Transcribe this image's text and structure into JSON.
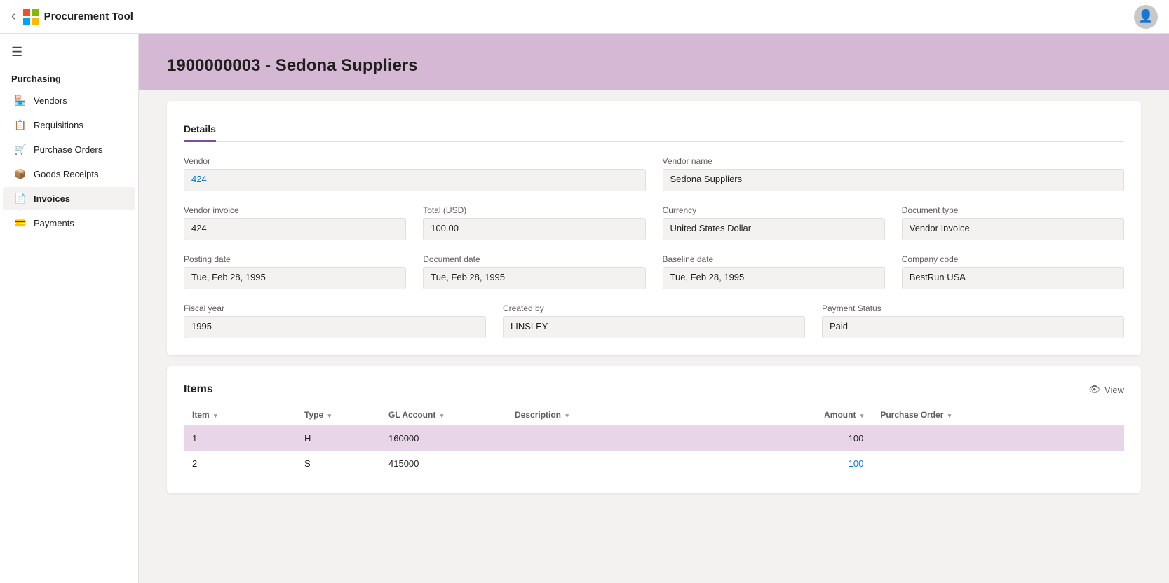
{
  "app": {
    "title": "Microsoft  Procurement Tool"
  },
  "topbar": {
    "back_label": "‹",
    "app_name": "Procurement Tool"
  },
  "sidebar": {
    "section_label": "Purchasing",
    "hamburger": "☰",
    "items": [
      {
        "id": "vendors",
        "label": "Vendors",
        "icon": "🏪",
        "active": false
      },
      {
        "id": "requisitions",
        "label": "Requisitions",
        "icon": "📋",
        "active": false
      },
      {
        "id": "purchase-orders",
        "label": "Purchase Orders",
        "icon": "🛒",
        "active": false
      },
      {
        "id": "goods-receipts",
        "label": "Goods Receipts",
        "icon": "📦",
        "active": false
      },
      {
        "id": "invoices",
        "label": "Invoices",
        "icon": "📄",
        "active": true
      },
      {
        "id": "payments",
        "label": "Payments",
        "icon": "💳",
        "active": false
      }
    ]
  },
  "page": {
    "title": "1900000003 - Sedona Suppliers",
    "tab_label": "Details"
  },
  "details": {
    "vendor_label": "Vendor",
    "vendor_value": "424",
    "vendor_name_label": "Vendor name",
    "vendor_name_value": "Sedona Suppliers",
    "vendor_invoice_label": "Vendor invoice",
    "vendor_invoice_value": "424",
    "total_label": "Total (USD)",
    "total_value": "100.00",
    "currency_label": "Currency",
    "currency_value": "United States Dollar",
    "document_type_label": "Document type",
    "document_type_value": "Vendor Invoice",
    "posting_date_label": "Posting date",
    "posting_date_value": "Tue, Feb 28, 1995",
    "document_date_label": "Document date",
    "document_date_value": "Tue, Feb 28, 1995",
    "baseline_date_label": "Baseline date",
    "baseline_date_value": "Tue, Feb 28, 1995",
    "company_code_label": "Company code",
    "company_code_value": "BestRun USA",
    "fiscal_year_label": "Fiscal year",
    "fiscal_year_value": "1995",
    "created_by_label": "Created by",
    "created_by_value": "LINSLEY",
    "payment_status_label": "Payment Status",
    "payment_status_value": "Paid"
  },
  "items_section": {
    "title": "Items",
    "view_label": "View",
    "columns": {
      "item": "Item",
      "type": "Type",
      "gl_account": "GL Account",
      "description": "Description",
      "amount": "Amount",
      "purchase_order": "Purchase Order"
    },
    "rows": [
      {
        "item": "1",
        "type": "H",
        "gl_account": "160000",
        "description": "",
        "amount": "100",
        "purchase_order": "",
        "highlighted": true
      },
      {
        "item": "2",
        "type": "S",
        "gl_account": "415000",
        "description": "",
        "amount": "100",
        "purchase_order": "",
        "highlighted": false
      }
    ]
  },
  "colors": {
    "accent": "#7b4f9e",
    "header_bg": "#d4b8d4",
    "highlight_row": "#e8d5e8",
    "link": "#0078d4"
  }
}
